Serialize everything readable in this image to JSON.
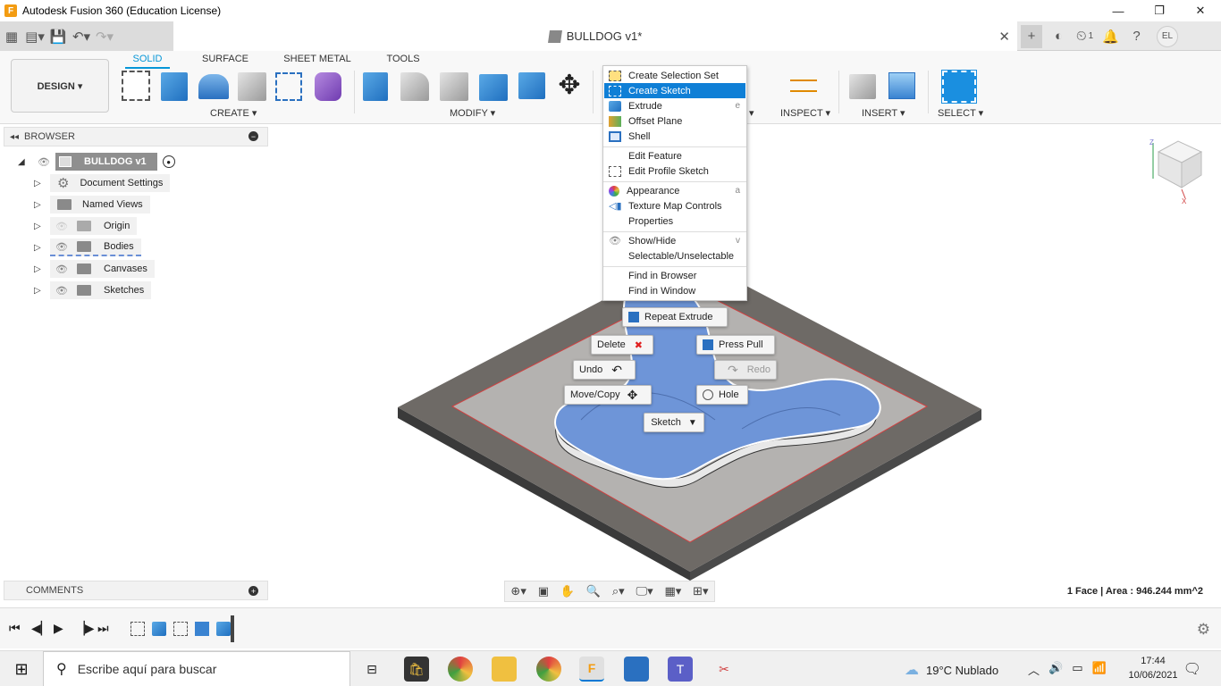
{
  "window": {
    "title": "Autodesk Fusion 360 (Education License)",
    "app_icon": "F",
    "minimize": "—",
    "maximize": "❐",
    "close": "✕"
  },
  "appbar": {
    "doc_title": "BULLDOG v1*",
    "jobs_count": "1",
    "user_initials": "EL"
  },
  "toolbar": {
    "workspace": "DESIGN ▾",
    "tabs": [
      "SOLID",
      "SURFACE",
      "SHEET METAL",
      "TOOLS"
    ],
    "groups": {
      "create": "CREATE ▾",
      "modify": "MODIFY ▾",
      "inspect": "INSPECT ▾",
      "insert": "INSERT ▾",
      "select": "SELECT ▾"
    }
  },
  "browser": {
    "title": "BROWSER",
    "root": "BULLDOG v1",
    "items": [
      "Document Settings",
      "Named Views",
      "Origin",
      "Bodies",
      "Canvases",
      "Sketches"
    ]
  },
  "comments": {
    "title": "COMMENTS"
  },
  "context_menu": {
    "items": [
      {
        "label": "Create Selection Set",
        "key": ""
      },
      {
        "label": "Create Sketch",
        "key": ""
      },
      {
        "label": "Extrude",
        "key": "e"
      },
      {
        "label": "Offset Plane",
        "key": ""
      },
      {
        "label": "Shell",
        "key": ""
      },
      {
        "label": "Edit Feature",
        "key": ""
      },
      {
        "label": "Edit Profile Sketch",
        "key": ""
      },
      {
        "label": "Appearance",
        "key": "a"
      },
      {
        "label": "Texture Map Controls",
        "key": ""
      },
      {
        "label": "Properties",
        "key": ""
      },
      {
        "label": "Show/Hide",
        "key": "v"
      },
      {
        "label": "Selectable/Unselectable",
        "key": ""
      },
      {
        "label": "Find in Browser",
        "key": ""
      },
      {
        "label": "Find in Window",
        "key": ""
      }
    ],
    "highlighted": "Create Sketch"
  },
  "marking_menu": {
    "repeat": "Repeat Extrude",
    "delete": "Delete",
    "press_pull": "Press Pull",
    "undo": "Undo",
    "redo": "Redo",
    "move_copy": "Move/Copy",
    "hole": "Hole",
    "sketch": "Sketch"
  },
  "status": {
    "selection": "1 Face | Area : 946.244 mm^2"
  },
  "taskbar": {
    "search_placeholder": "Escribe aquí para buscar",
    "weather": "19°C  Nublado",
    "time": "17:44",
    "date": "10/06/2021"
  },
  "colors": {
    "accent": "#0696d7",
    "menu_highlight": "#0f7fd6",
    "face_selected": "#6e95d8"
  }
}
